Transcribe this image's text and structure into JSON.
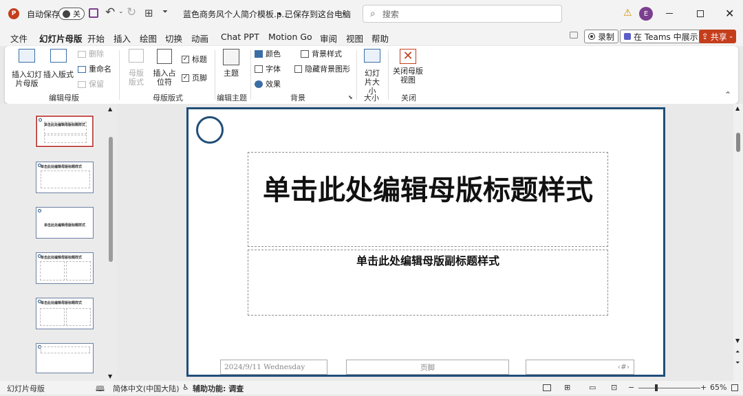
{
  "titlebar": {
    "autosave_label": "自动保存",
    "autosave_state": "关",
    "file_title": "蓝色商务风个人简介模板.p...",
    "save_status": "• 已保存到这台电脑",
    "search_placeholder": "搜索",
    "avatar_letter": "E"
  },
  "menu": {
    "items": [
      "文件",
      "幻灯片母版",
      "开始",
      "插入",
      "绘图",
      "切换",
      "动画",
      "Chat PPT",
      "Motion Go",
      "审阅",
      "视图",
      "帮助"
    ],
    "record": "录制",
    "teams": "在 Teams 中展示",
    "share": "共享"
  },
  "ribbon": {
    "insert_master": "插入幻灯片母版",
    "insert_layout": "插入版式",
    "delete": "删除",
    "rename": "重命名",
    "preserve": "保留",
    "group_edit_master": "编辑母版",
    "master_layout": "母版版式",
    "insert_placeholder": "插入占位符",
    "chk_title": "标题",
    "chk_footer": "页脚",
    "group_master_layout": "母版版式",
    "themes": "主题",
    "group_edit_theme": "编辑主题",
    "colors": "颜色",
    "fonts": "字体",
    "effects": "效果",
    "bg_styles": "背景样式",
    "hide_bg": "隐藏背景图形",
    "group_background": "背景",
    "slide_size": "幻灯片大小",
    "group_size": "大小",
    "close_master": "关闭母版视图",
    "group_close": "关闭"
  },
  "thumbnails": [
    {
      "title": "单击此处编辑母版标题样式"
    },
    {
      "title": "单击此处编辑母版标题样式"
    },
    {
      "title": "单击此处编辑母版标题样式"
    },
    {
      "title": "单击此处编辑母版标题样式"
    },
    {
      "title": "单击此处编辑母版标题样式"
    },
    {
      "title": ""
    }
  ],
  "slide": {
    "title": "单击此处编辑母版标题样式",
    "subtitle": "单击此处编辑母版副标题样式",
    "date": "2024/9/11 Wednesday",
    "footer": "页脚",
    "page_number": "‹#›"
  },
  "status": {
    "view": "幻灯片母版",
    "language": "简体中文(中国大陆)",
    "accessibility": "辅助功能: 调查",
    "zoom": "65%"
  },
  "colors": {
    "accent": "#c43e1c",
    "slide_border": "#1f4e79"
  }
}
